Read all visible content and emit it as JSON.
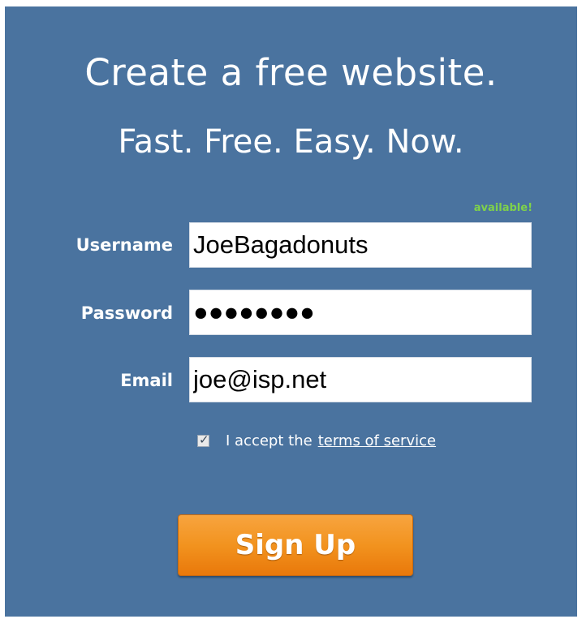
{
  "header": {
    "title": "Create a free website.",
    "subtitle": "Fast. Free. Easy. Now."
  },
  "form": {
    "username": {
      "label": "Username",
      "value": "JoeBagadonuts",
      "status": "available!"
    },
    "password": {
      "label": "Password",
      "value": "●●●●●●●●"
    },
    "email": {
      "label": "Email",
      "value": "joe@isp.net"
    },
    "terms": {
      "checked": true,
      "text": "I accept the",
      "link_text": "terms of service"
    },
    "submit_label": "Sign Up"
  },
  "colors": {
    "background": "#4a739f",
    "available": "#7fd24a",
    "button": "#f2931f"
  }
}
